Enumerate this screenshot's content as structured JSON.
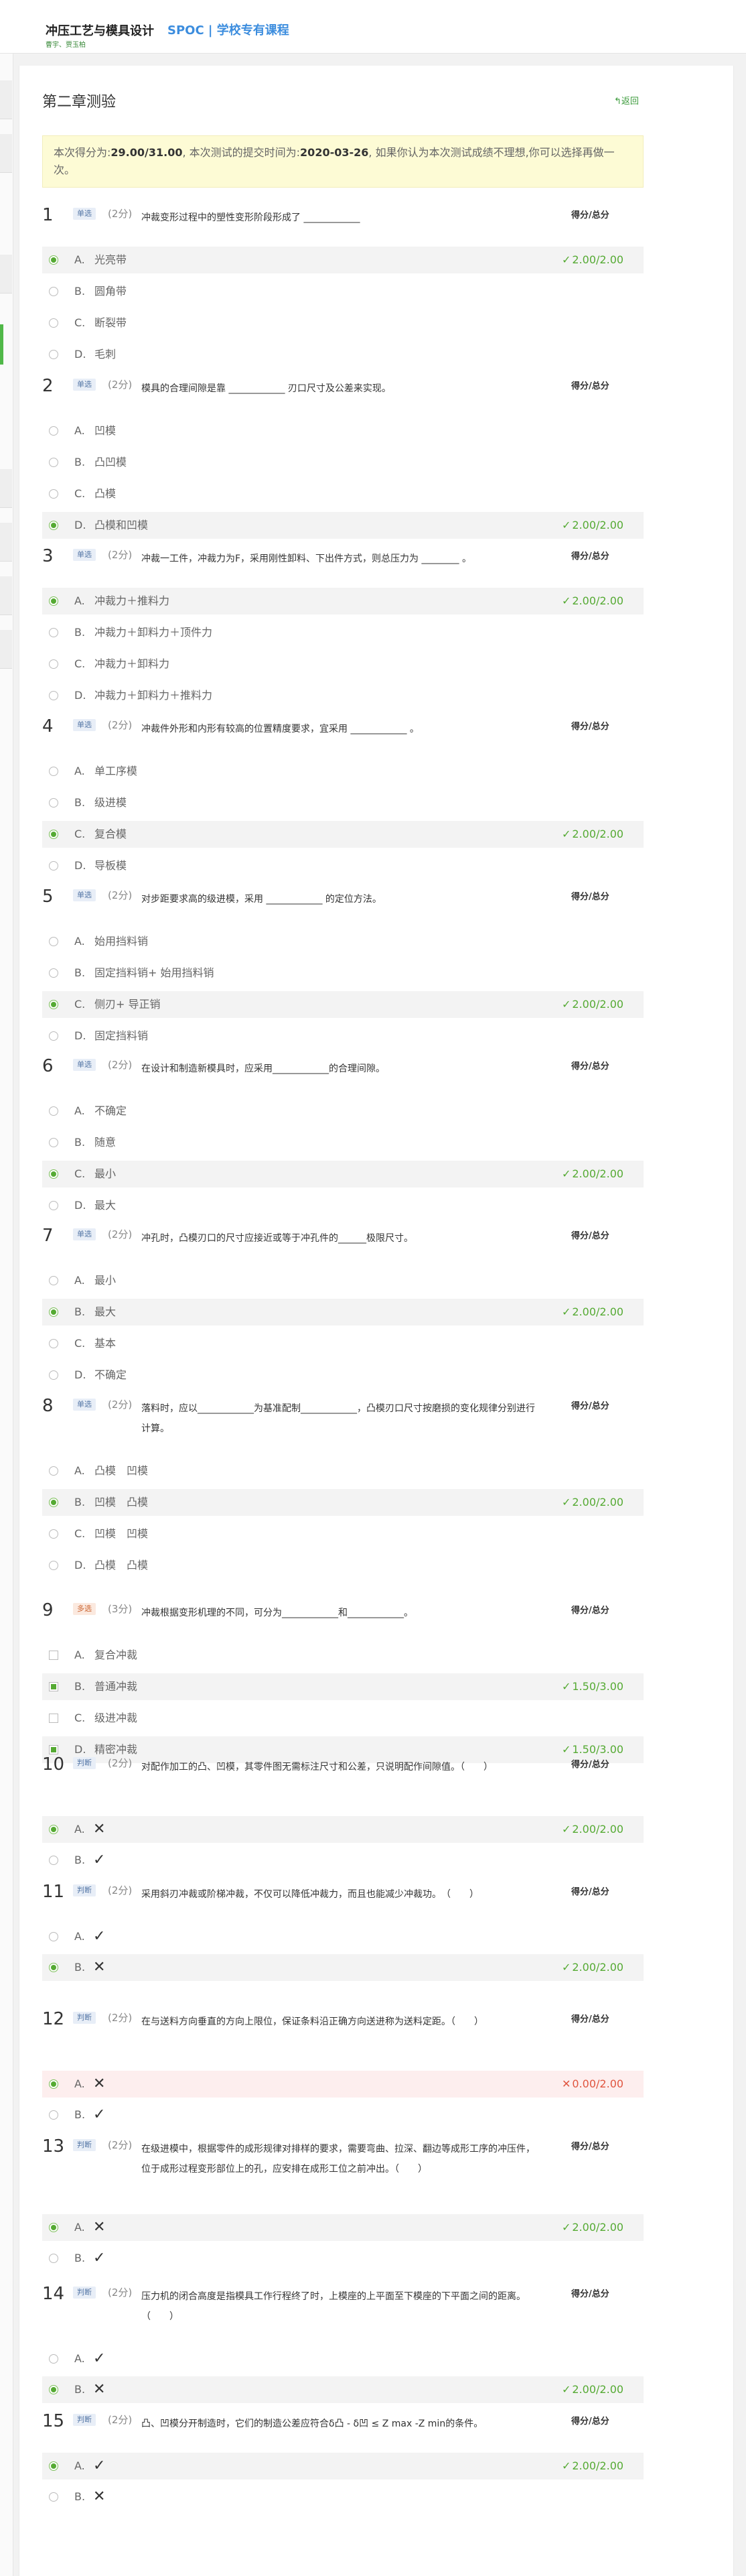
{
  "header": {
    "course_title": "冲压工艺与模具设计",
    "course_school": "曹宇、贾玉柏",
    "spoc": "SPOC | 学校专有课程"
  },
  "page": {
    "title": "第二章测验",
    "back": "返回"
  },
  "notice": {
    "prefix": "本次得分为:",
    "score": "29.00/31.00",
    "mid": ", 本次测试的提交时间为:",
    "date": "2020-03-26",
    "suffix": ", 如果你认为本次测试成绩不理想,你可以选择再做一次。"
  },
  "score_header": "得分/总分",
  "questions": [
    {
      "num": "1",
      "type": "单选",
      "points": "(2分)",
      "text": "冲裁变形过程中的塑性变形阶段形成了 ____________",
      "options": [
        {
          "l": "A.",
          "t": "光亮带",
          "sel": true,
          "res": "2.00/2.00"
        },
        {
          "l": "B.",
          "t": "圆角带"
        },
        {
          "l": "C.",
          "t": "断裂带"
        },
        {
          "l": "D.",
          "t": "毛刺"
        }
      ]
    },
    {
      "num": "2",
      "type": "单选",
      "points": "(2分)",
      "text": "模具的合理间隙是靠 ____________ 刃口尺寸及公差来实现。",
      "options": [
        {
          "l": "A.",
          "t": "凹模"
        },
        {
          "l": "B.",
          "t": "凸凹模"
        },
        {
          "l": "C.",
          "t": "凸模"
        },
        {
          "l": "D.",
          "t": "凸模和凹模",
          "sel": true,
          "res": "2.00/2.00"
        }
      ]
    },
    {
      "num": "3",
      "type": "单选",
      "points": "(2分)",
      "text": "冲裁一工件，冲裁力为F，采用刚性卸料、下出件方式，则总压力为 ________ 。",
      "options": [
        {
          "l": "A.",
          "t": "冲裁力＋推料力",
          "sel": true,
          "res": "2.00/2.00"
        },
        {
          "l": "B.",
          "t": "冲裁力＋卸料力＋顶件力"
        },
        {
          "l": "C.",
          "t": "冲裁力＋卸料力"
        },
        {
          "l": "D.",
          "t": "冲裁力＋卸料力＋推料力"
        }
      ]
    },
    {
      "num": "4",
      "type": "单选",
      "points": "(2分)",
      "text": "冲裁件外形和内形有较高的位置精度要求，宜采用 ____________ 。",
      "options": [
        {
          "l": "A.",
          "t": "单工序模"
        },
        {
          "l": "B.",
          "t": "级进模"
        },
        {
          "l": "C.",
          "t": "复合模",
          "sel": true,
          "res": "2.00/2.00"
        },
        {
          "l": "D.",
          "t": "导板模"
        }
      ]
    },
    {
      "num": "5",
      "type": "单选",
      "points": "(2分)",
      "text": "对步距要求高的级进模，采用 ____________ 的定位方法。",
      "options": [
        {
          "l": "A.",
          "t": "始用挡料销"
        },
        {
          "l": "B.",
          "t": "固定挡料销+ 始用挡料销"
        },
        {
          "l": "C.",
          "t": "侧刃+ 导正销",
          "sel": true,
          "res": "2.00/2.00"
        },
        {
          "l": "D.",
          "t": "固定挡料销"
        }
      ]
    },
    {
      "num": "6",
      "type": "单选",
      "points": "(2分)",
      "text": "在设计和制造新模具时，应采用____________的合理间隙。",
      "options": [
        {
          "l": "A.",
          "t": "不确定"
        },
        {
          "l": "B.",
          "t": "随意"
        },
        {
          "l": "C.",
          "t": "最小",
          "sel": true,
          "res": "2.00/2.00"
        },
        {
          "l": "D.",
          "t": "最大"
        }
      ]
    },
    {
      "num": "7",
      "type": "单选",
      "points": "(2分)",
      "text": "冲孔时，凸模刃口的尺寸应接近或等于冲孔件的______极限尺寸。",
      "options": [
        {
          "l": "A.",
          "t": "最小"
        },
        {
          "l": "B.",
          "t": "最大",
          "sel": true,
          "res": "2.00/2.00"
        },
        {
          "l": "C.",
          "t": "基本"
        },
        {
          "l": "D.",
          "t": "不确定"
        }
      ]
    },
    {
      "num": "8",
      "type": "单选",
      "points": "(2分)",
      "text": "落料时，应以____________为基准配制____________，凸模刃口尺寸按磨损的变化规律分别进行计算。",
      "options": [
        {
          "l": "A.",
          "t": "凸模　凹模"
        },
        {
          "l": "B.",
          "t": "凹模　凸模",
          "sel": true,
          "res": "2.00/2.00"
        },
        {
          "l": "C.",
          "t": "凹模　凹模"
        },
        {
          "l": "D.",
          "t": "凸模　凸模"
        }
      ]
    },
    {
      "num": "9",
      "type": "多选",
      "points": "(3分)",
      "text": "冲裁根据变形机理的不同，可分为____________和____________。",
      "options": [
        {
          "l": "A.",
          "t": "复合冲裁"
        },
        {
          "l": "B.",
          "t": "普通冲裁",
          "sel": true,
          "res": "1.50/3.00"
        },
        {
          "l": "C.",
          "t": "级进冲裁"
        },
        {
          "l": "D.",
          "t": "精密冲裁",
          "sel": true,
          "res": "1.50/3.00"
        }
      ]
    },
    {
      "num": "10",
      "type": "判断",
      "points": "(2分)",
      "text": "对配作加工的凸、凹模，其零件图无需标注尺寸和公差，只说明配作间隙值。（　　）",
      "options": [
        {
          "l": "A.",
          "m": "✕",
          "sel": true,
          "res": "2.00/2.00"
        },
        {
          "l": "B.",
          "m": "✓"
        }
      ]
    },
    {
      "num": "11",
      "type": "判断",
      "points": "(2分)",
      "text": "采用斜刃冲裁或阶梯冲裁，不仅可以降低冲裁力，而且也能减少冲裁功。　（　　）",
      "options": [
        {
          "l": "A.",
          "m": "✓"
        },
        {
          "l": "B.",
          "m": "✕",
          "sel": true,
          "res": "2.00/2.00"
        }
      ]
    },
    {
      "num": "12",
      "type": "判断",
      "points": "(2分)",
      "text": "在与送料方向垂直的方向上限位，保证条料沿正确方向送进称为送料定距。（　　）",
      "options": [
        {
          "l": "A.",
          "m": "✕",
          "sel": true,
          "res": "0.00/2.00",
          "bad": true
        },
        {
          "l": "B.",
          "m": "✓"
        }
      ]
    },
    {
      "num": "13",
      "type": "判断",
      "points": "(2分)",
      "text": "在级进模中，根据零件的成形规律对排样的要求，需要弯曲、拉深、翻边等成形工序的冲压件，位于成形过程变形部位上的孔，应安排在成形工位之前冲出。（　　）",
      "options": [
        {
          "l": "A.",
          "m": "✕",
          "sel": true,
          "res": "2.00/2.00"
        },
        {
          "l": "B.",
          "m": "✓"
        }
      ]
    },
    {
      "num": "14",
      "type": "判断",
      "points": "(2分)",
      "text": "压力机的闭合高度是指模具工作行程终了时，上模座的上平面至下模座的下平面之间的距离。（　　）",
      "options": [
        {
          "l": "A.",
          "m": "✓"
        },
        {
          "l": "B.",
          "m": "✕",
          "sel": true,
          "res": "2.00/2.00"
        }
      ]
    },
    {
      "num": "15",
      "type": "判断",
      "points": "(2分)",
      "text": "凸、凹模分开制造时，它们的制造公差应符合δ凸 - δ凹 ≤ Z max -Z min的条件。",
      "options": [
        {
          "l": "A.",
          "m": "✓",
          "sel": true,
          "res": "2.00/2.00"
        },
        {
          "l": "B.",
          "m": "✕"
        }
      ]
    }
  ],
  "colors": {
    "accent": "#55aa33",
    "wrong": "#e0553f",
    "notice_bg": "#fdfbd5"
  }
}
